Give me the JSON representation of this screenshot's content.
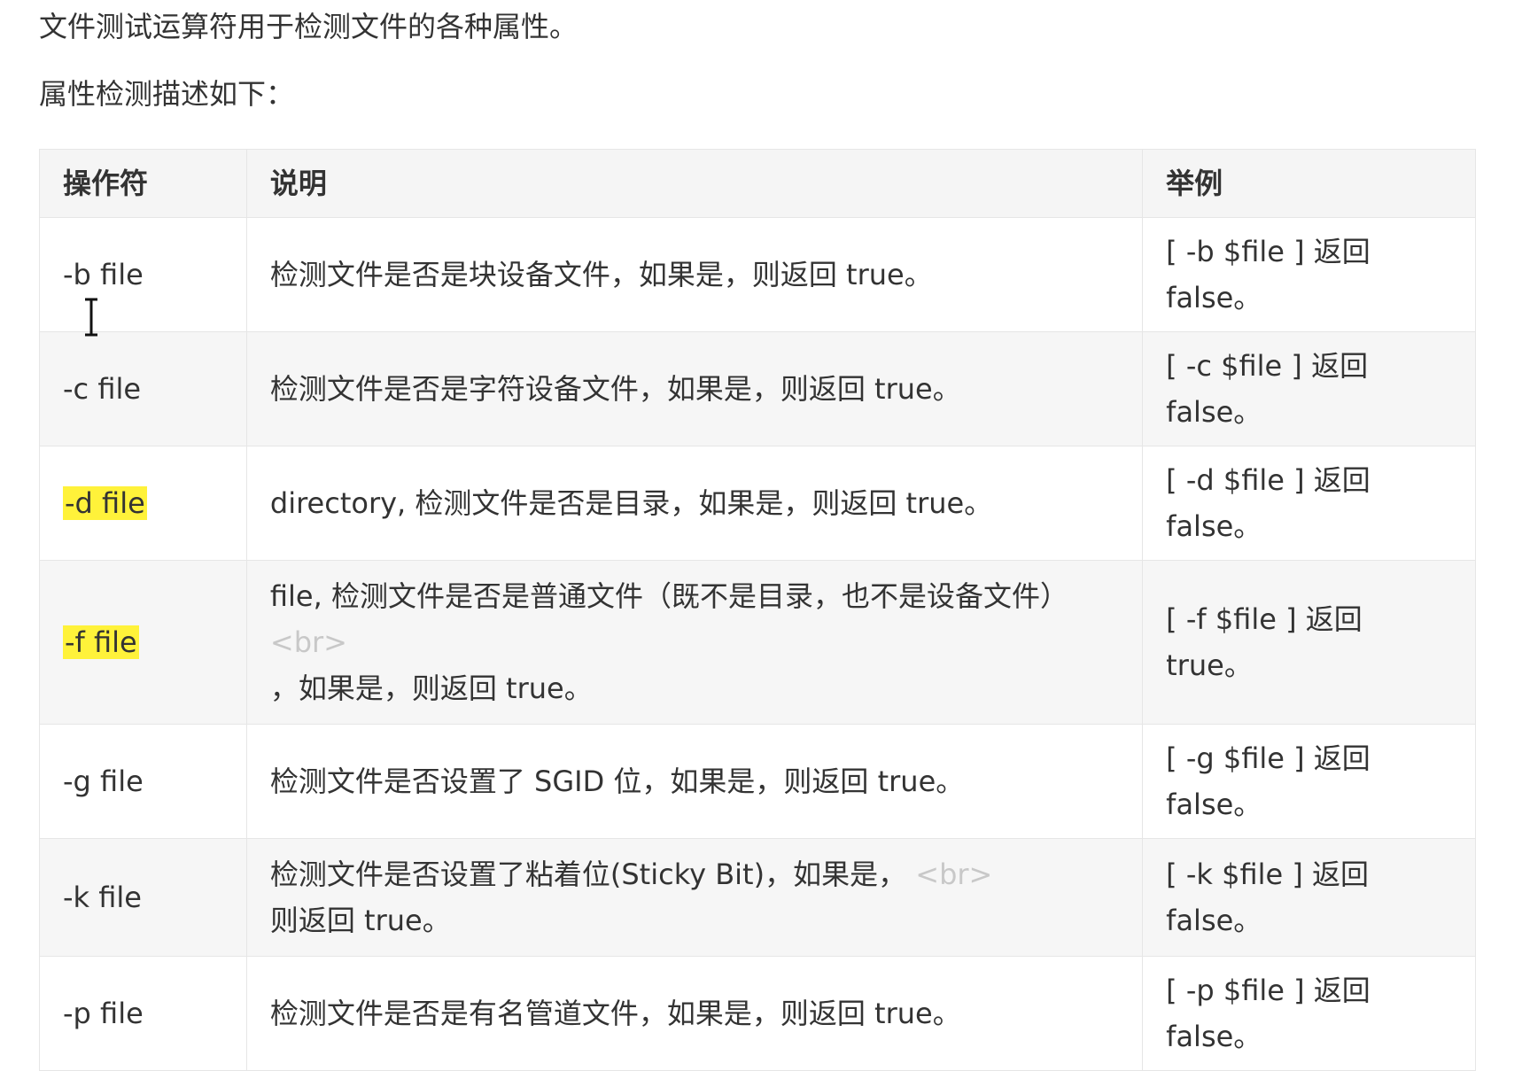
{
  "intro": {
    "line1": "文件测试运算符用于检测文件的各种属性。",
    "line2": "属性检测描述如下："
  },
  "table": {
    "headers": {
      "operator": "操作符",
      "description": "说明",
      "example": "举例"
    },
    "rows": [
      {
        "operator": "-b file",
        "highlighted": false,
        "description": "检测文件是否是块设备文件，如果是，则返回 true。",
        "example_line1": "[ -b $file ] 返回",
        "example_line2": "false。"
      },
      {
        "operator": "-c file",
        "highlighted": false,
        "description": "检测文件是否是字符设备文件，如果是，则返回 true。",
        "example_line1": "[ -c $file ] 返回",
        "example_line2": "false。"
      },
      {
        "operator": "-d file",
        "highlighted": true,
        "description": "directory, 检测文件是否是目录，如果是，则返回 true。",
        "example_line1": "[ -d $file ] 返回",
        "example_line2": "false。"
      },
      {
        "operator": "-f file",
        "highlighted": true,
        "description_line1": "file, 检测文件是否是普通文件（既不是目录，也不是设备文件）",
        "description_br": "<br>",
        "description_line2": "，如果是，则返回 true。",
        "example": "[ -f $file ] 返回 true。"
      },
      {
        "operator": "-g file",
        "highlighted": false,
        "description": "检测文件是否设置了 SGID 位，如果是，则返回 true。",
        "example_line1": "[ -g $file ] 返回",
        "example_line2": "false。"
      },
      {
        "operator": "-k file",
        "highlighted": false,
        "description_line1": "检测文件是否设置了粘着位(Sticky Bit)，如果是，",
        "description_br": "<br>",
        "description_line2": "则返回 true。",
        "example_line1": "[ -k $file ] 返回",
        "example_line2": "false。"
      },
      {
        "operator": "-p file",
        "highlighted": false,
        "description": "检测文件是否是有名管道文件，如果是，则返回 true。",
        "example_line1": "[ -p $file ] 返回",
        "example_line2": "false。"
      }
    ]
  },
  "colors": {
    "highlight": "#fff23a",
    "header_bg": "#f5f5f5",
    "row_alt_bg": "#f6f6f6",
    "border": "#e6e6e6",
    "br_tag_text": "#c8c8c8"
  },
  "cursor": {
    "icon": "text-cursor-icon"
  }
}
